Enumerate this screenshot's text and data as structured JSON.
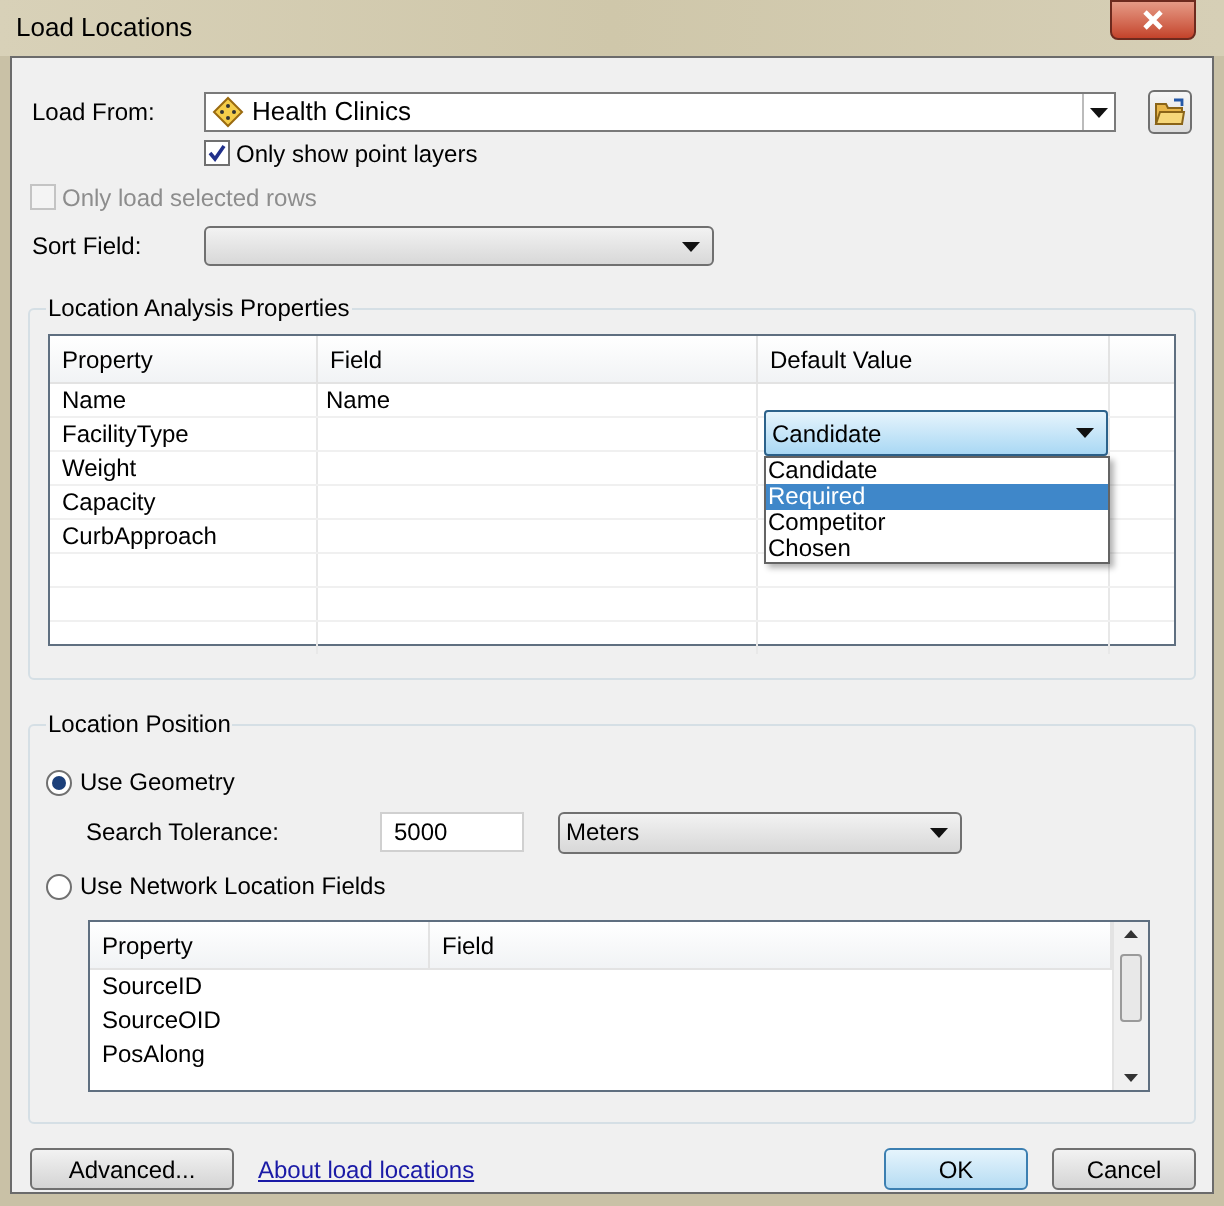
{
  "window": {
    "title": "Load Locations"
  },
  "load_from": {
    "label": "Load From:",
    "value": "Health Clinics",
    "point_layers": {
      "label": "Only show point layers",
      "checked": true
    }
  },
  "only_selected": {
    "label": "Only load selected rows",
    "checked": false,
    "disabled": true
  },
  "sort_field": {
    "label": "Sort Field:"
  },
  "analysis": {
    "title": "Location Analysis Properties",
    "columns": [
      "Property",
      "Field",
      "Default Value"
    ],
    "rows": [
      {
        "property": "Name",
        "field": "Name"
      },
      {
        "property": "FacilityType",
        "default_value": {
          "value": "Candidate",
          "expanded": true,
          "options": [
            {
              "label": "Candidate",
              "highlighted": false
            },
            {
              "label": "Required",
              "highlighted": true
            },
            {
              "label": "Competitor",
              "highlighted": false
            },
            {
              "label": "Chosen",
              "highlighted": false
            }
          ]
        }
      },
      {
        "property": "Weight"
      },
      {
        "property": "Capacity"
      },
      {
        "property": "CurbApproach"
      }
    ]
  },
  "position": {
    "title": "Location Position",
    "use_geometry": {
      "label": "Use Geometry",
      "selected": true
    },
    "search_tolerance": {
      "label": "Search Tolerance:",
      "value": "5000",
      "units": "Meters"
    },
    "use_network": {
      "label": "Use Network Location Fields",
      "selected": false
    },
    "network_table": {
      "columns": [
        "Property",
        "Field"
      ],
      "rows": [
        {
          "property": "SourceID"
        },
        {
          "property": "SourceOID"
        },
        {
          "property": "PosAlong"
        }
      ]
    }
  },
  "buttons": {
    "advanced": "Advanced...",
    "about": "About load locations",
    "ok": "OK",
    "cancel": "Cancel"
  }
}
